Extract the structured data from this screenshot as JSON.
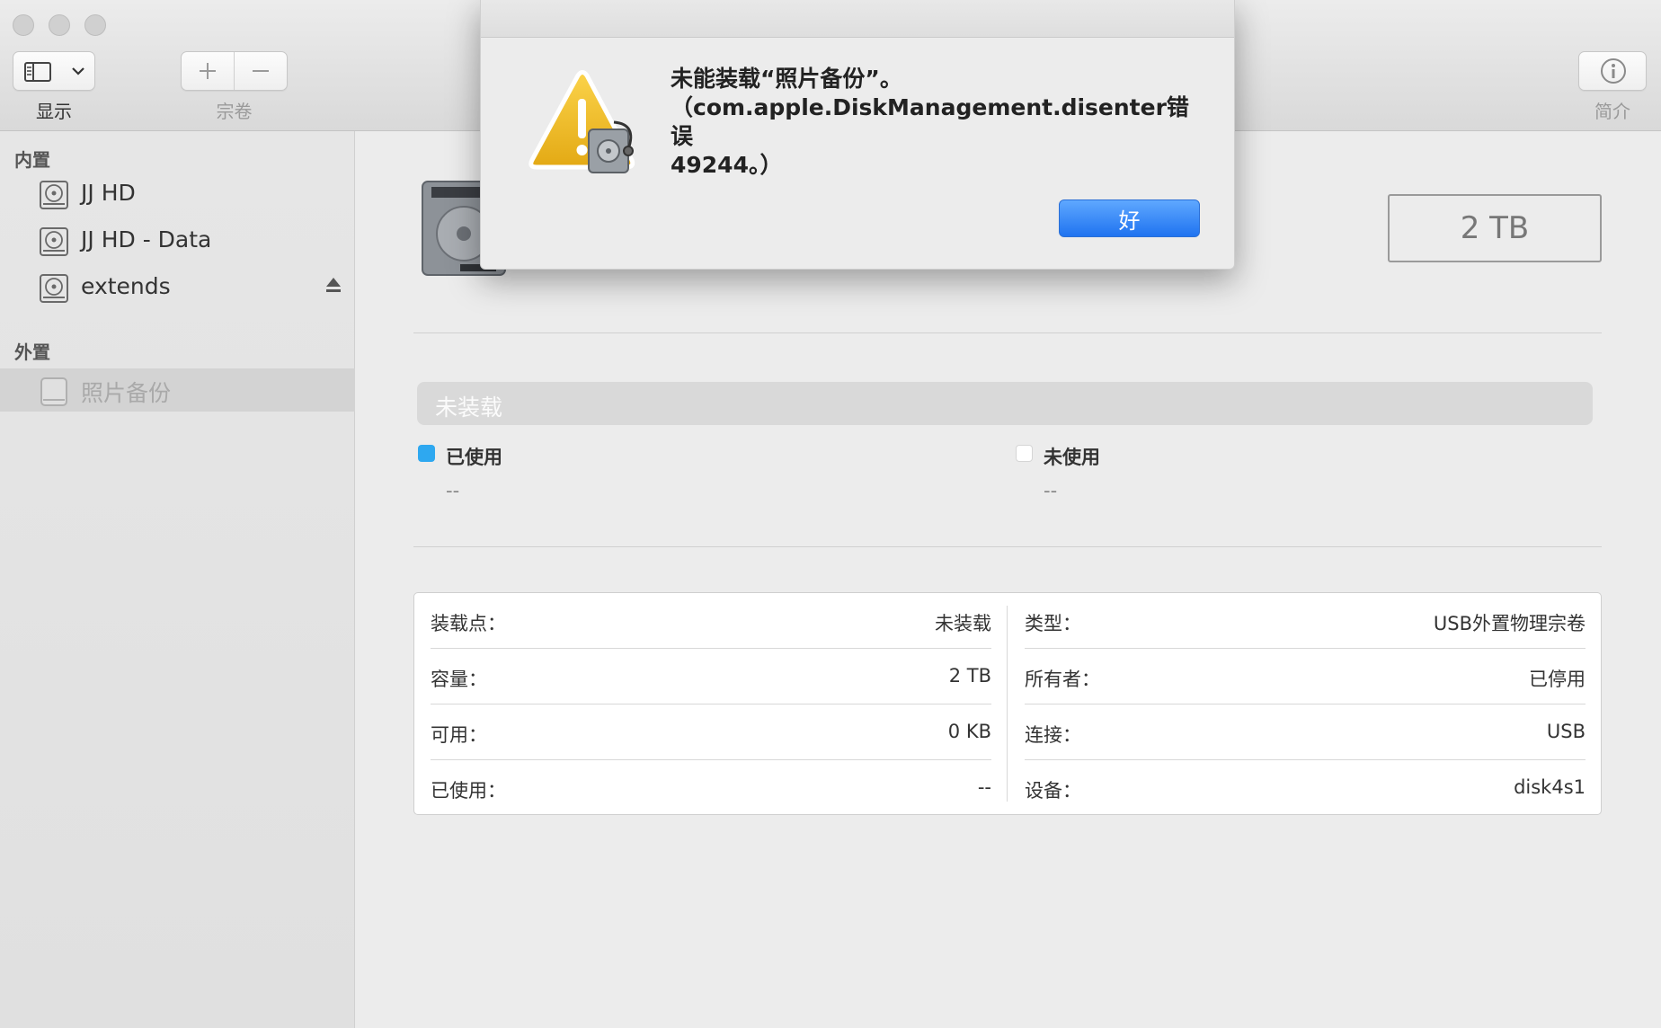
{
  "toolbar": {
    "view_label": "显示",
    "volume_label": "宗卷",
    "info_label": "简介"
  },
  "sidebar": {
    "internal_header": "内置",
    "external_header": "外置",
    "internal_items": [
      {
        "label": "JJ HD"
      },
      {
        "label": "JJ HD - Data"
      },
      {
        "label": "extends"
      }
    ],
    "external_items": [
      {
        "label": "照片备份"
      }
    ]
  },
  "main": {
    "capacity": "2 TB",
    "status_bar": "未装载",
    "used_label": "已使用",
    "used_value": "--",
    "free_label": "未使用",
    "free_value": "--",
    "colors": {
      "used": "#2ea8f0",
      "free": "#ffffff"
    },
    "info_left": [
      {
        "key": "装载点：",
        "value": "未装载"
      },
      {
        "key": "容量：",
        "value": "2 TB"
      },
      {
        "key": "可用：",
        "value": "0 KB"
      },
      {
        "key": "已使用：",
        "value": "--"
      }
    ],
    "info_right": [
      {
        "key": "类型：",
        "value": "USB外置物理宗卷"
      },
      {
        "key": "所有者：",
        "value": "已停用"
      },
      {
        "key": "连接：",
        "value": "USB"
      },
      {
        "key": "设备：",
        "value": "disk4s1"
      }
    ]
  },
  "alert": {
    "line1": "未能装载“照片备份”。",
    "line2": "（com.apple.DiskManagement.disenter错误",
    "line3": "49244。）",
    "ok_label": "好"
  }
}
